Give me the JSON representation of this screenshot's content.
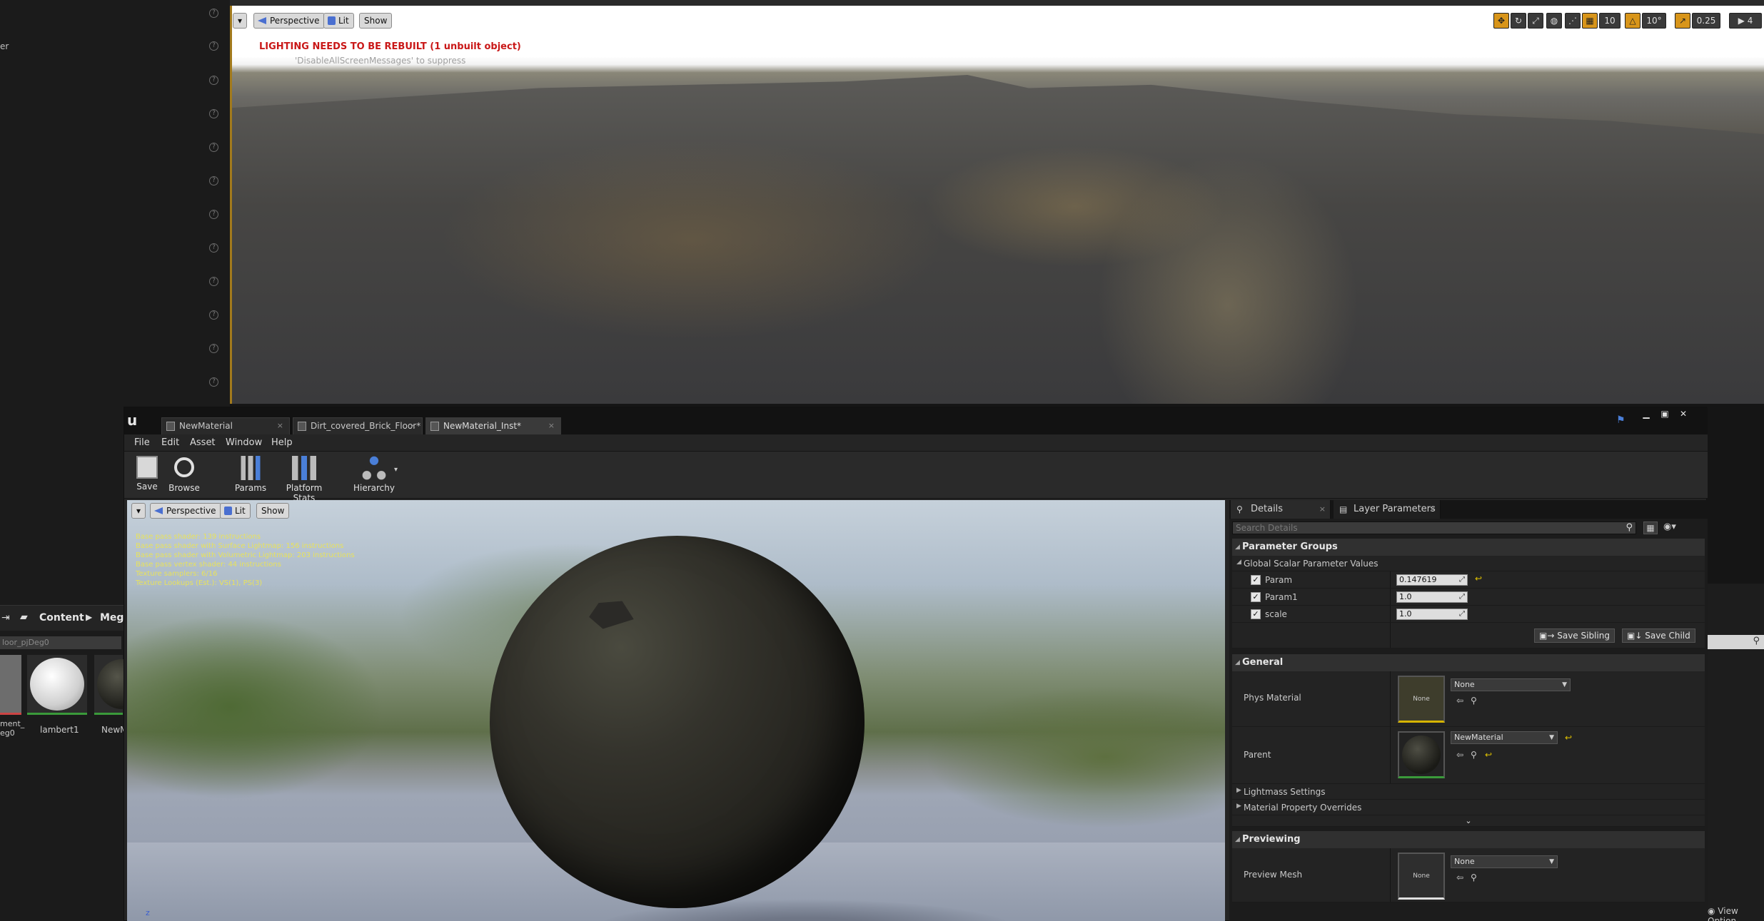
{
  "left_panel": {
    "partial_label": "er"
  },
  "main_viewport": {
    "view_mode": "Perspective",
    "lighting": "Lit",
    "show": "Show",
    "warning": "LIGHTING NEEDS TO BE REBUILT (1 unbuilt object)",
    "suppress_hint": "'DisableAllScreenMessages' to suppress",
    "grid_snap": "10",
    "rotation_snap": "10°",
    "scale_snap": "0.25",
    "camera_speed": "4"
  },
  "content_browser": {
    "path_root": "Content",
    "path_next": "Meg",
    "search_text": "loor_pjDeg0",
    "thumbs": [
      "ment_\neg0",
      "lambert1",
      "NewM"
    ]
  },
  "right_strip": {
    "view_options": "View Option"
  },
  "editor": {
    "tabs": [
      "NewMaterial",
      "Dirt_covered_Brick_Floor*",
      "NewMaterial_Inst*"
    ],
    "menu": [
      "File",
      "Edit",
      "Asset",
      "Window",
      "Help"
    ],
    "toolbar": {
      "save": "Save",
      "browse": "Browse",
      "params": "Params",
      "platform_stats": "Platform Stats",
      "hierarchy": "Hierarchy"
    },
    "preview": {
      "view_mode": "Perspective",
      "lighting": "Lit",
      "show": "Show",
      "stats": [
        "Base pass shader: 139 instructions",
        "Base pass shader with Surface Lightmap: 156 instructions",
        "Base pass shader with Volumetric Lightmap: 203 instructions",
        "Base pass vertex shader: 44 instructions",
        "Texture samplers: 6/16",
        "Texture Lookups (Est.): VS(1), PS(3)"
      ]
    },
    "details": {
      "tab_details": "Details",
      "tab_layers": "Layer Parameters",
      "search_placeholder": "Search Details",
      "param_groups": "Parameter Groups",
      "global_scalar": "Global Scalar Parameter Values",
      "params": [
        {
          "name": "Param",
          "value": "0.147619"
        },
        {
          "name": "Param1",
          "value": "1.0"
        },
        {
          "name": "scale",
          "value": "1.0"
        }
      ],
      "save_sibling": "Save Sibling",
      "save_child": "Save Child",
      "general": "General",
      "phys_material_label": "Phys Material",
      "phys_material_value": "None",
      "phys_thumb": "None",
      "parent_label": "Parent",
      "parent_value": "NewMaterial",
      "lightmass": "Lightmass Settings",
      "overrides": "Material Property Overrides",
      "previewing": "Previewing",
      "preview_mesh_label": "Preview Mesh",
      "preview_mesh_value": "None",
      "preview_thumb": "None"
    }
  }
}
